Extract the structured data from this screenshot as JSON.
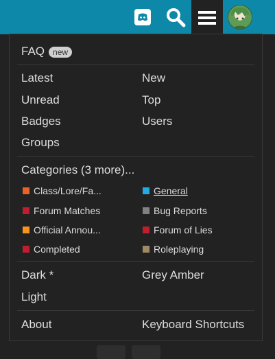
{
  "header": {
    "discord_icon": "discord-icon",
    "search_icon": "search-icon",
    "menu_icon": "hamburger-menu-icon",
    "avatar": "user-avatar",
    "color": "#0e88a8"
  },
  "menu": {
    "faq": "FAQ",
    "faq_badge": "new",
    "links_left": [
      "Latest",
      "Unread",
      "Badges",
      "Groups"
    ],
    "links_right": [
      "New",
      "Top",
      "Users"
    ],
    "categories_heading": "Categories (3 more)...",
    "categories": [
      {
        "name": "Class/Lore/Fa...",
        "color": "#e8622a"
      },
      {
        "name": "General",
        "color": "#25aae1"
      },
      {
        "name": "Forum Matches",
        "color": "#bf1e2e"
      },
      {
        "name": "Bug Reports",
        "color": "#808281"
      },
      {
        "name": "Official Annou...",
        "color": "#f7941d"
      },
      {
        "name": "Forum of Lies",
        "color": "#bf1e2e"
      },
      {
        "name": "Completed",
        "color": "#bf1e2e"
      },
      {
        "name": "Roleplaying",
        "color": "#a08a64"
      }
    ],
    "themes": [
      "Dark *",
      "Grey Amber",
      "Light"
    ],
    "about": "About",
    "keyboard_shortcuts": "Keyboard Shortcuts"
  }
}
